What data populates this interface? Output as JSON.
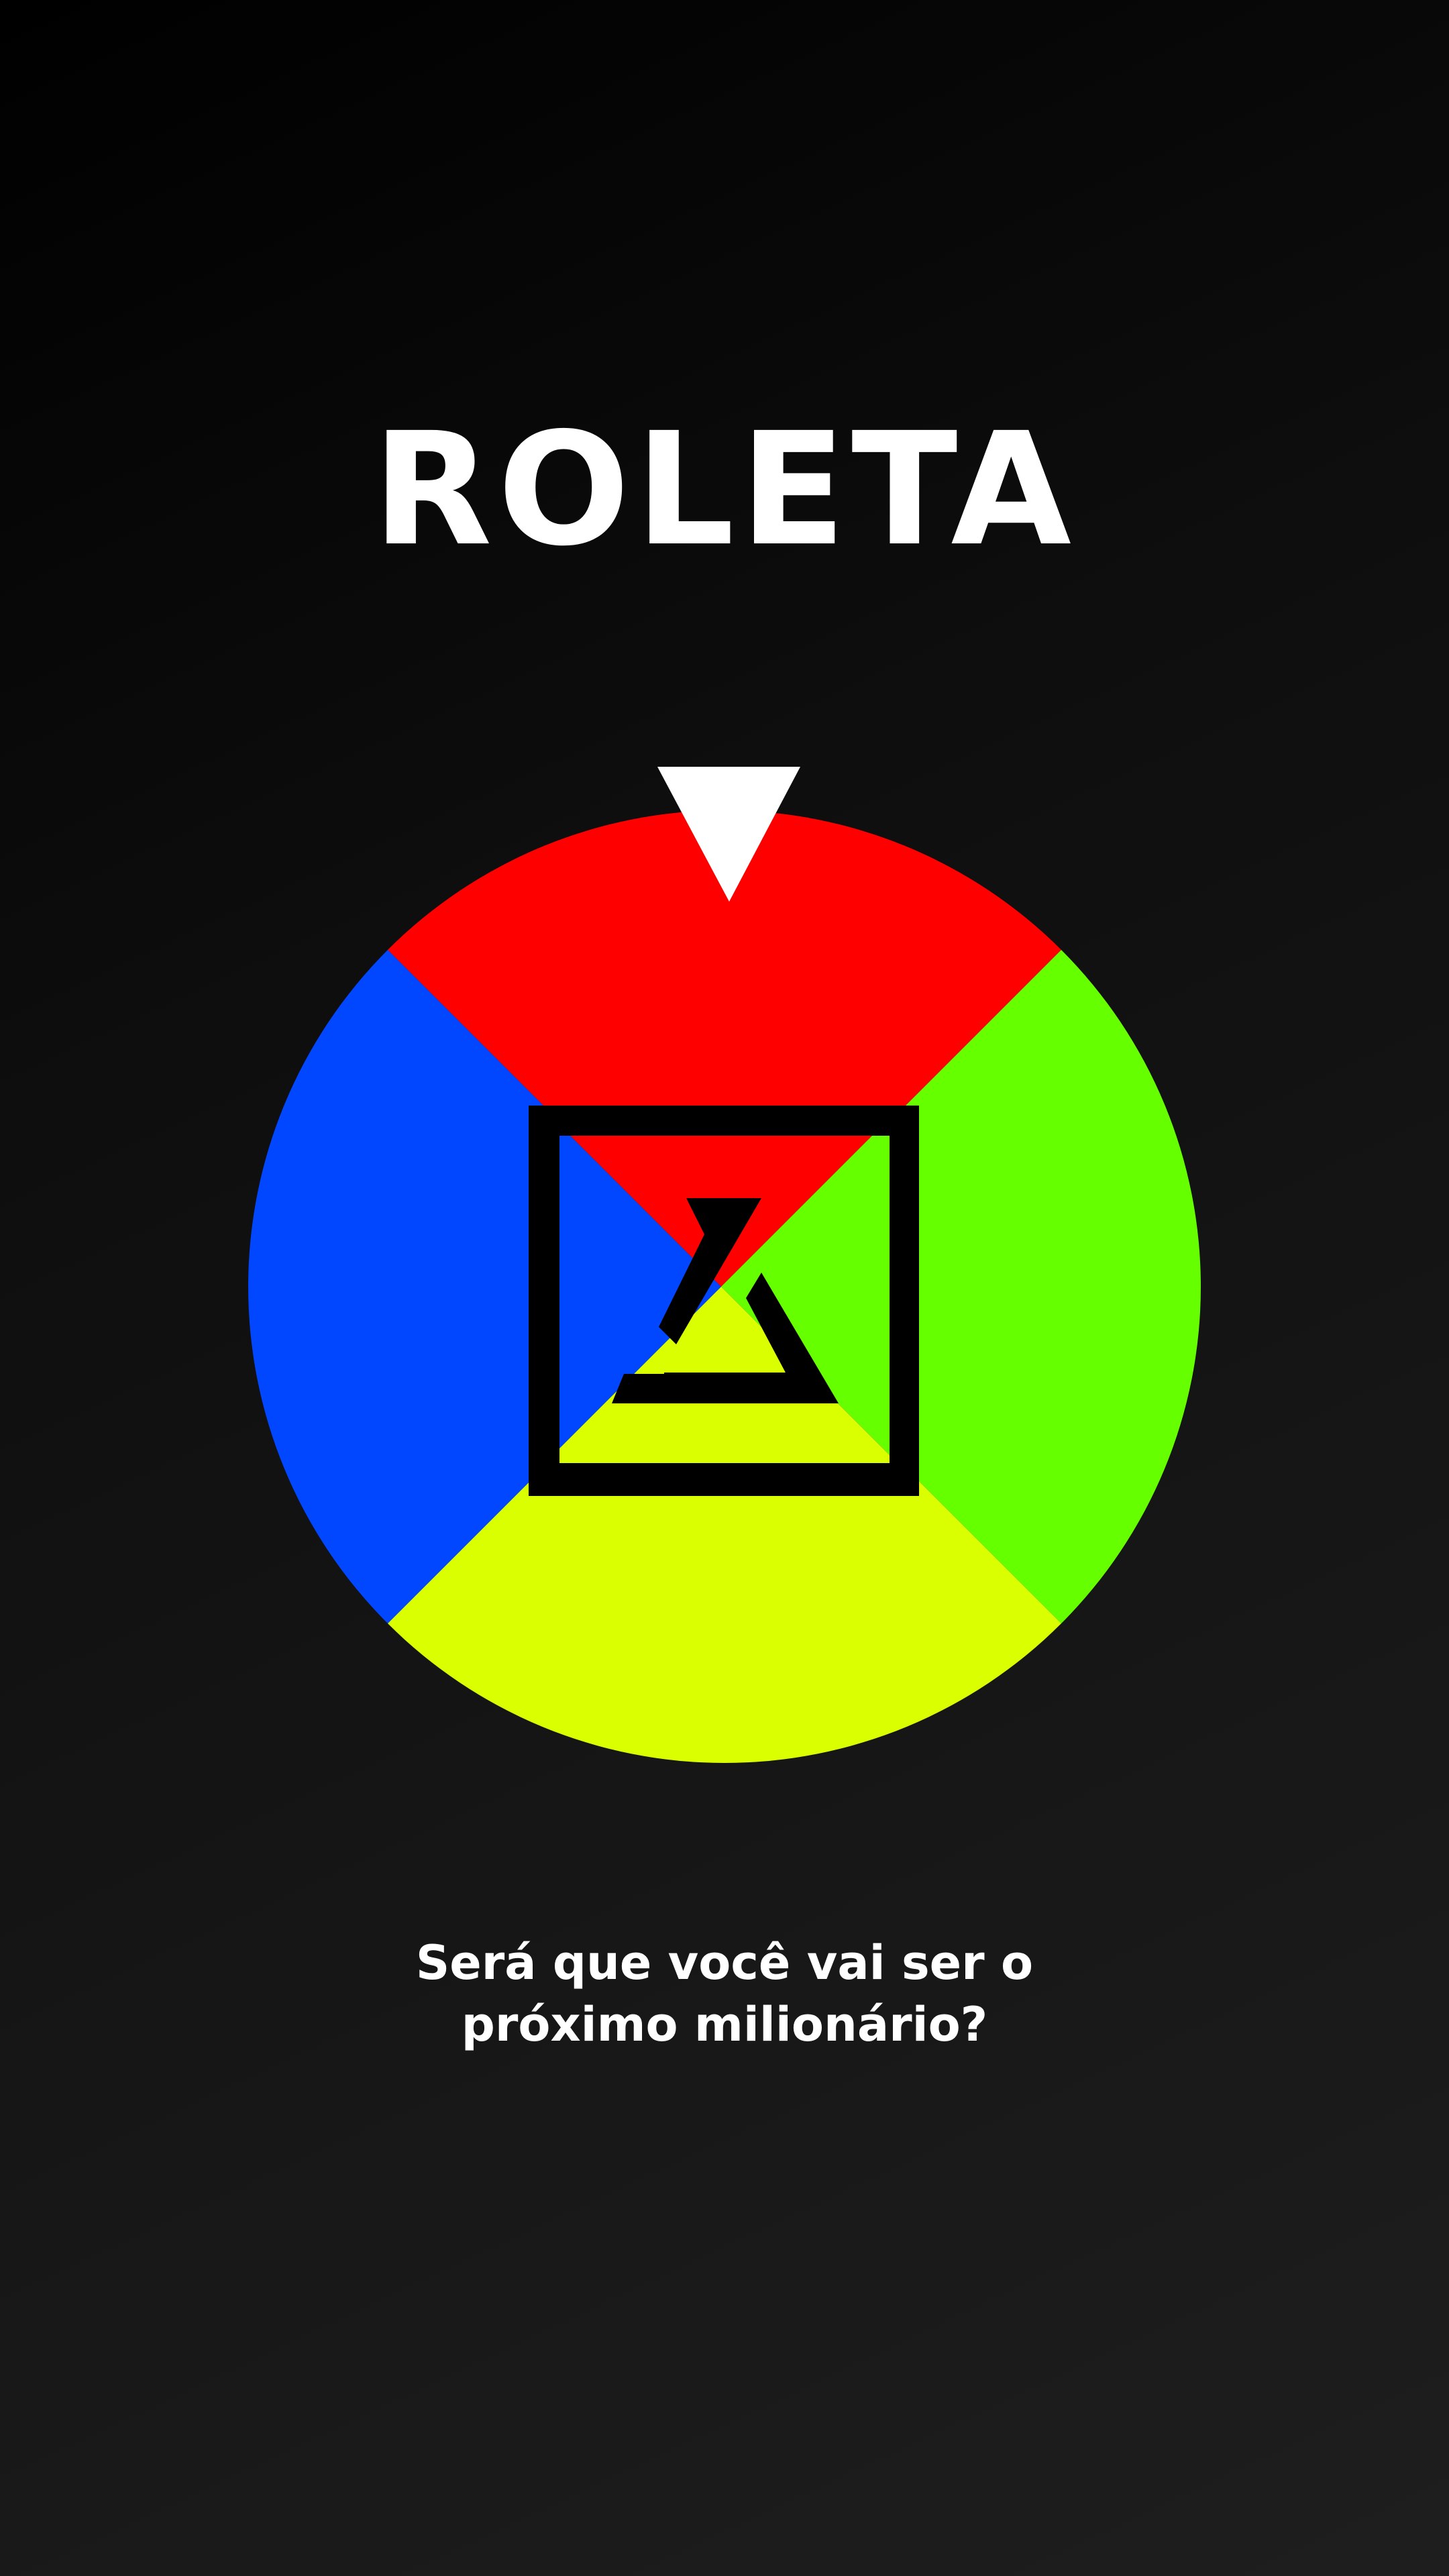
{
  "app": {
    "title": "ROLETA"
  },
  "wheel": {
    "segments": [
      {
        "name": "top",
        "color": "#ff0000"
      },
      {
        "name": "right",
        "color": "#66ff00"
      },
      {
        "name": "bottom",
        "color": "#d9ff00"
      },
      {
        "name": "left",
        "color": "#0047ff"
      }
    ],
    "pointer_color": "#ffffff",
    "center_icon": "hourglass-icon",
    "center_frame_color": "#000000"
  },
  "tagline": {
    "line1": "Será que você vai ser o",
    "line2": "próximo milionário?"
  },
  "colors": {
    "background_start": "#000000",
    "background_end": "#1e1e1e",
    "text": "#ffffff"
  }
}
